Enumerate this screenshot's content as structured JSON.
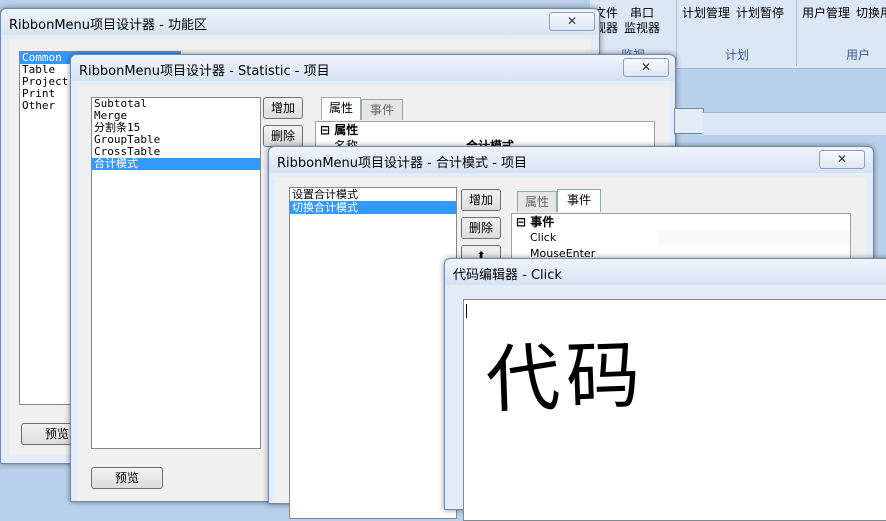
{
  "ribbon": {
    "group1": {
      "btn1_l1": "文件",
      "btn1_l2": "视器",
      "btn2_l1": "串口",
      "btn2_l2": "监视器",
      "caption": "监视"
    },
    "group2": {
      "btn1": "计划管理",
      "btn2": "计划暂停",
      "caption": "计划"
    },
    "group3": {
      "btn1": "用户管理",
      "btn2": "切换用",
      "caption": "用户"
    }
  },
  "win1": {
    "title": "RibbonMenu项目设计器 - 功能区",
    "close": "✕",
    "list": [
      "Common",
      "Table",
      "Project",
      "Print",
      "Other"
    ],
    "preview": "预览"
  },
  "win2": {
    "title": "RibbonMenu项目设计器 - Statistic - 项目",
    "close": "✕",
    "list": [
      "Subtotal",
      "Merge",
      "分割条15",
      "GroupTable",
      "CrossTable",
      "合计模式"
    ],
    "add": "增加",
    "delete": "删除",
    "tab_props": "属性",
    "tab_events": "事件",
    "section": "属性",
    "name_key": "名称",
    "name_value": "合计模式",
    "preview": "预览"
  },
  "win3": {
    "title": "RibbonMenu项目设计器 - 合计模式 - 项目",
    "close": "✕",
    "list": [
      "设置合计模式",
      "切换合计模式"
    ],
    "add": "增加",
    "delete": "删除",
    "up": "⬆",
    "tab_props": "属性",
    "tab_events": "事件",
    "section": "事件",
    "events": [
      "Click",
      "MouseEnter"
    ]
  },
  "win4": {
    "title": "代码编辑器 - Click",
    "content": "代码"
  }
}
